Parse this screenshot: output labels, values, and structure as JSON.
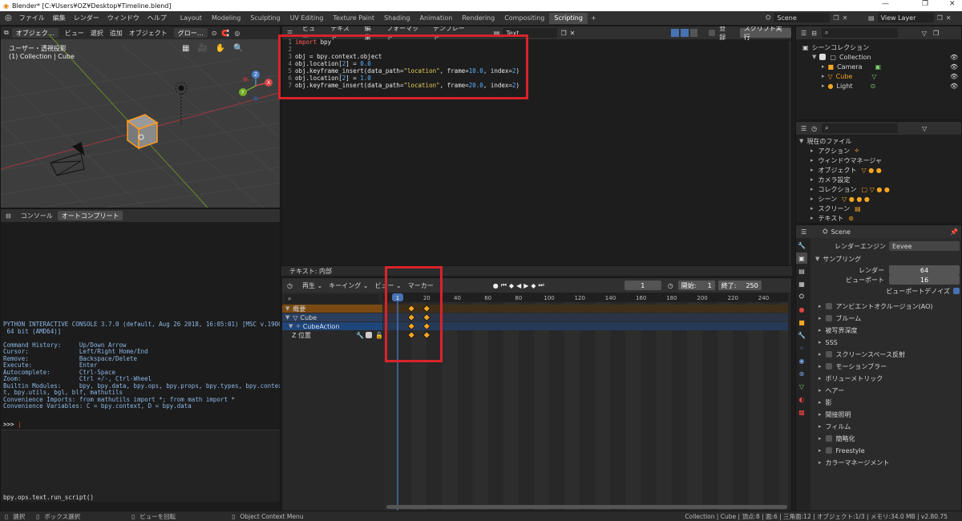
{
  "window": {
    "title": "Blender* [C:¥Users¥OZ¥Desktop¥Timeline.blend]",
    "controls": [
      "—",
      "❐",
      "✕"
    ]
  },
  "topbar": {
    "menus": [
      "ファイル",
      "編集",
      "レンダー",
      "ウィンドウ",
      "ヘルプ"
    ],
    "workspaces": [
      "Layout",
      "Modeling",
      "Sculpting",
      "UV Editing",
      "Texture Paint",
      "Shading",
      "Animation",
      "Rendering",
      "Compositing",
      "Scripting"
    ],
    "active_workspace": "Scripting",
    "scene": "Scene",
    "view_layer": "View Layer"
  },
  "viewport": {
    "mode": "オブジェク…",
    "menus": [
      "ビュー",
      "選択",
      "追加",
      "オブジェクト"
    ],
    "transform": "グロー…",
    "view_label": "ユーザー・透視投影",
    "collection_label": "(1) Collection | Cube"
  },
  "text_editor": {
    "menus": [
      "ビュー",
      "テキスト",
      "編集",
      "フォーマット",
      "テンプレート"
    ],
    "text_name": "Text",
    "register_label": "登録",
    "run_script": "スクリプト実行",
    "footer": "テキスト: 内部",
    "lines": [
      {
        "n": "1",
        "code": "import bpy"
      },
      {
        "n": "2",
        "code": ""
      },
      {
        "n": "3",
        "code": "obj = bpy.context.object"
      },
      {
        "n": "4",
        "code": "obj.location[2] = 0.0"
      },
      {
        "n": "5",
        "code": "obj.keyframe_insert(data_path=\"location\", frame=10.0, index=2)"
      },
      {
        "n": "6",
        "code": "obj.location[2] = 1.0"
      },
      {
        "n": "7",
        "code": "obj.keyframe_insert(data_path=\"location\", frame=20.0, index=2)"
      }
    ]
  },
  "console": {
    "tabs": [
      "コンソール",
      "オートコンプリート"
    ],
    "lines": [
      "PYTHON INTERACTIVE CONSOLE 3.7.0 (default, Aug 26 2018, 16:05:01) [MSC v.1900",
      " 64 bit (AMD64)]",
      "",
      "Command History:     Up/Down Arrow",
      "Cursor:              Left/Right Home/End",
      "Remove:              Backspace/Delete",
      "Execute:             Enter",
      "Autocomplete:        Ctrl-Space",
      "Zoom:                Ctrl +/-, Ctrl-Wheel",
      "Builtin Modules:     bpy, bpy.data, bpy.ops, bpy.props, bpy.types, bpy.contex",
      "t, bpy.utils, bgl, blf, mathutils",
      "Convenience Imports: from mathutils import *; from math import *",
      "Convenience Variables: C = bpy.context, D = bpy.data"
    ],
    "prompt": ">>> ",
    "info": "bpy.ops.text.run_script()"
  },
  "timeline": {
    "menus": [
      "再生",
      "キーイング",
      "ビュー",
      "マーカー"
    ],
    "current_frame": "1",
    "start_label": "開始:",
    "start": "1",
    "end_label": "終了:",
    "end": "250",
    "ruler": [
      "1",
      "20",
      "40",
      "60",
      "80",
      "100",
      "120",
      "140",
      "160",
      "180",
      "200",
      "220",
      "240"
    ],
    "channels": [
      "概要",
      "Cube",
      "CubeAction",
      "Z 位置"
    ],
    "keyframe_frames": [
      10,
      20
    ]
  },
  "outliner": {
    "root": "シーンコレクション",
    "collection": "Collection",
    "items": [
      "Camera",
      "Cube",
      "Light"
    ]
  },
  "datablocks": {
    "header": "現在のファイル",
    "items": [
      "アクション",
      "ウィンドウマネージャ",
      "オブジェクト",
      "カメラ設定",
      "コレクション",
      "シーン",
      "スクリーン",
      "テキスト"
    ]
  },
  "properties": {
    "scene": "Scene",
    "render_engine_label": "レンダーエンジン",
    "render_engine": "Eevee",
    "sampling": "サンプリング",
    "render_label": "レンダー",
    "render_value": "64",
    "viewport_label": "ビューポート",
    "viewport_value": "16",
    "denoise": "ビューポートデノイズ",
    "sections": [
      {
        "label": "アンビエントオクルージョン(AO)",
        "checkbox": true
      },
      {
        "label": "ブルーム",
        "checkbox": true
      },
      {
        "label": "被写界深度",
        "checkbox": false
      },
      {
        "label": "SSS",
        "checkbox": false
      },
      {
        "label": "スクリーンスペース反射",
        "checkbox": true
      },
      {
        "label": "モーションブラー",
        "checkbox": true
      },
      {
        "label": "ボリューメトリック",
        "checkbox": false
      },
      {
        "label": "ヘアー",
        "checkbox": false
      },
      {
        "label": "影",
        "checkbox": false
      },
      {
        "label": "間接照明",
        "checkbox": false
      },
      {
        "label": "フィルム",
        "checkbox": false
      },
      {
        "label": "簡略化",
        "checkbox": true
      },
      {
        "label": "Freestyle",
        "checkbox": true
      },
      {
        "label": "カラーマネージメント",
        "checkbox": false
      }
    ]
  },
  "statusbar": {
    "left": [
      "選択",
      "ボックス選択",
      "ビューを回転",
      "Object Context Menu"
    ],
    "right": "Collection | Cube | 頂点:8 | 面:6 | 三角面:12 | オブジェクト:1/3 | メモリ:34.0 MB | v2.80.75"
  }
}
